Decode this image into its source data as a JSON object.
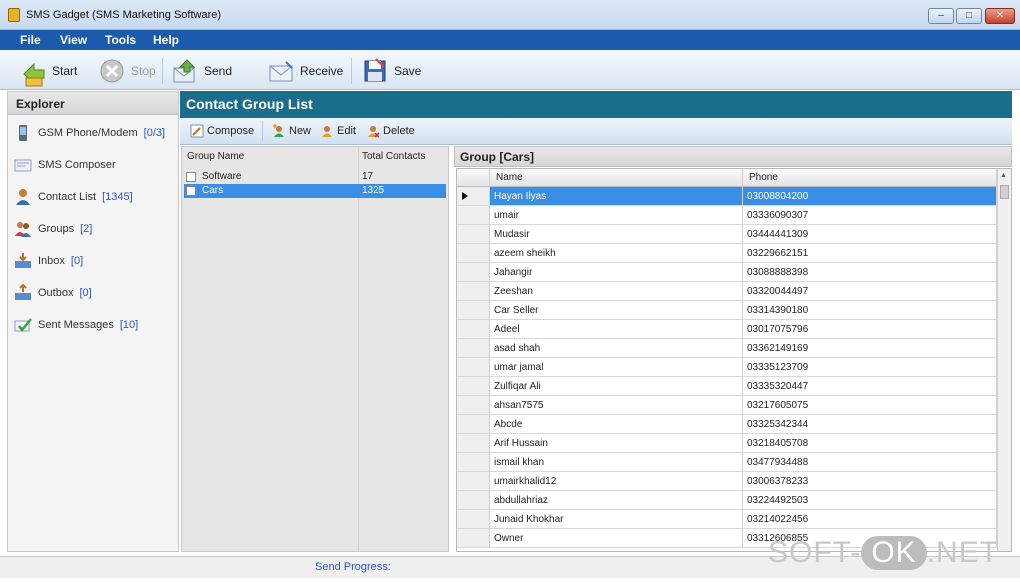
{
  "window": {
    "title": "SMS Gadget (SMS Marketing Software)",
    "minimize": "–",
    "maximize": "□",
    "close": "✕"
  },
  "menu": [
    "File",
    "View",
    "Tools",
    "Help"
  ],
  "toolbar": {
    "start": "Start",
    "stop": "Stop",
    "send": "Send",
    "receive": "Receive",
    "save": "Save"
  },
  "explorer": {
    "title": "Explorer",
    "items": [
      {
        "label": "GSM Phone/Modem",
        "count": "[0/3]",
        "icon": "phone-icon"
      },
      {
        "label": "SMS Composer",
        "count": "",
        "icon": "composer-icon"
      },
      {
        "label": "Contact List",
        "count": "[1345]",
        "icon": "contact-icon"
      },
      {
        "label": "Groups",
        "count": "[2]",
        "icon": "groups-icon"
      },
      {
        "label": "Inbox",
        "count": "[0]",
        "icon": "inbox-icon"
      },
      {
        "label": "Outbox",
        "count": "[0]",
        "icon": "outbox-icon"
      },
      {
        "label": "Sent Messages",
        "count": "[10]",
        "icon": "sent-icon"
      }
    ]
  },
  "contact_group": {
    "title": "Contact Group List",
    "actions": {
      "compose": "Compose",
      "new": "New",
      "edit": "Edit",
      "delete": "Delete"
    },
    "columns": {
      "name": "Group Name",
      "total": "Total Contacts"
    },
    "groups": [
      {
        "name": "Software",
        "total": "17",
        "selected": false
      },
      {
        "name": "Cars",
        "total": "1325",
        "selected": true
      }
    ]
  },
  "group_detail": {
    "title": "Group [Cars]",
    "columns": {
      "name": "Name",
      "phone": "Phone"
    },
    "rows": [
      {
        "name": "Hayan Ilyas",
        "phone": "03008804200"
      },
      {
        "name": "umair",
        "phone": "03336090307"
      },
      {
        "name": "Mudasir",
        "phone": "03444441309"
      },
      {
        "name": "azeem sheikh",
        "phone": "03229662151"
      },
      {
        "name": "Jahangir",
        "phone": "03088888398"
      },
      {
        "name": "Zeeshan",
        "phone": "03320044497"
      },
      {
        "name": "Car Seller",
        "phone": "03314390180"
      },
      {
        "name": "Adeel",
        "phone": "03017075796"
      },
      {
        "name": "asad shah",
        "phone": "03362149169"
      },
      {
        "name": "umar jamal",
        "phone": "03335123709"
      },
      {
        "name": "Zulfiqar Ali",
        "phone": "03335320447"
      },
      {
        "name": "ahsan7575",
        "phone": "03217605075"
      },
      {
        "name": "Abcde",
        "phone": "03325342344"
      },
      {
        "name": "Arif Hussain",
        "phone": "03218405708"
      },
      {
        "name": "ismail khan",
        "phone": "03477934488"
      },
      {
        "name": "umairkhalid12",
        "phone": "03006378233"
      },
      {
        "name": "abdullahriaz",
        "phone": "03224492503"
      },
      {
        "name": "Junaid Khokhar",
        "phone": "03214022456"
      },
      {
        "name": "Owner",
        "phone": "03312606855"
      }
    ]
  },
  "status": {
    "progress_label": "Send Progress:"
  },
  "watermark": {
    "left": "SOFT-",
    "ok": "OK",
    "right": ".NET"
  }
}
